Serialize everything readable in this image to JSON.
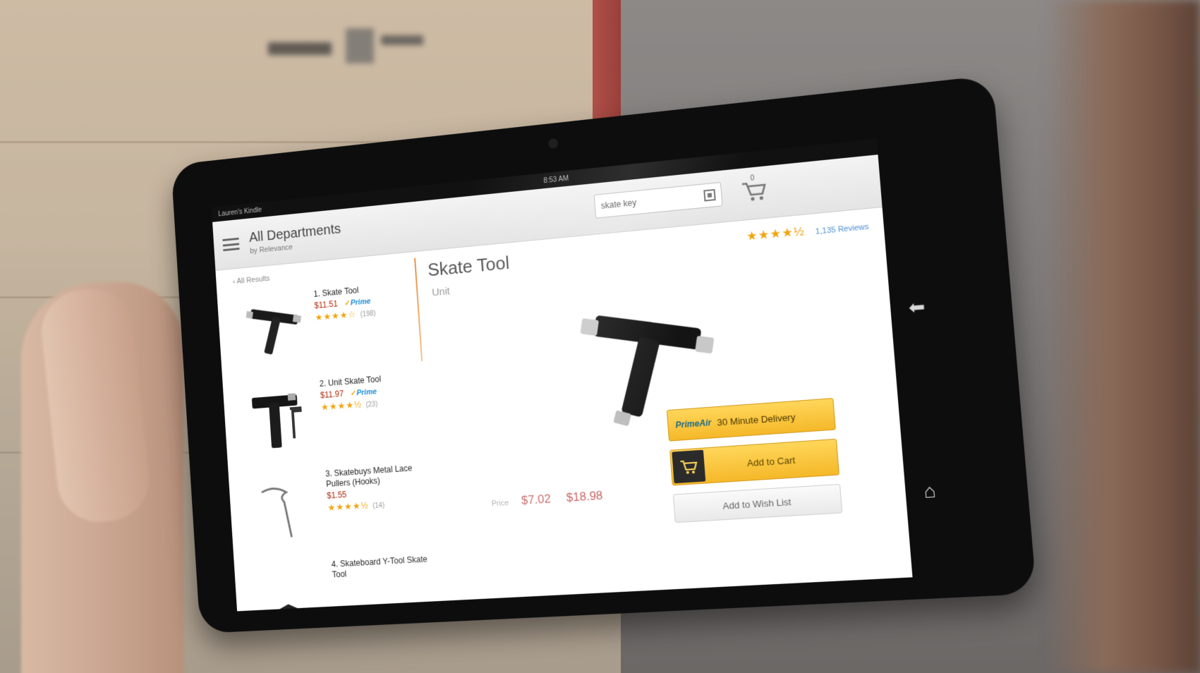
{
  "status_bar": {
    "carrier": "Lauren's Kindle",
    "time": "8:53 AM",
    "icons": "▾ ▮"
  },
  "header": {
    "department": "All Departments",
    "sub": "by Relevance",
    "search_value": "skate key",
    "cart_count": "0"
  },
  "results": {
    "back_label": "All Results",
    "items": [
      {
        "title": "1. Skate Tool",
        "price": "$11.51",
        "prime": "Prime",
        "rating": 4,
        "reviews": "(198)"
      },
      {
        "title": "2. Unit Skate Tool",
        "price": "$11.97",
        "prime": "Prime",
        "rating": 4.5,
        "reviews": "(23)"
      },
      {
        "title": "3. Skatebuys Metal Lace Pullers (Hooks)",
        "price": "$1.55",
        "prime": "",
        "rating": 4.5,
        "reviews": "(14)"
      },
      {
        "title": "4. Skateboard Y-Tool Skate Tool",
        "price": "",
        "prime": "",
        "rating": 0,
        "reviews": ""
      }
    ]
  },
  "detail": {
    "title": "Skate Tool",
    "brand": "Unit",
    "rating": 4.5,
    "review_link": "1,135 Reviews",
    "price_label": "Price",
    "price_from": "$7.02",
    "price_to": "$18.98",
    "prime_air_logo": "PrimeAir",
    "prime_air_label": "30 Minute Delivery",
    "add_to_cart_label": "Add to Cart",
    "wishlist_label": "Add to Wish List"
  },
  "colors": {
    "accent_button": "#f5b829",
    "price": "#b12704",
    "star": "#f0a40b",
    "prime_blue": "#1a8dd6",
    "divider_orange": "#e98b3d"
  },
  "icons": {
    "menu": "hamburger-icon",
    "scan": "scan-icon",
    "cart": "cart-icon",
    "back": "back-arrow-icon",
    "home": "home-icon"
  }
}
